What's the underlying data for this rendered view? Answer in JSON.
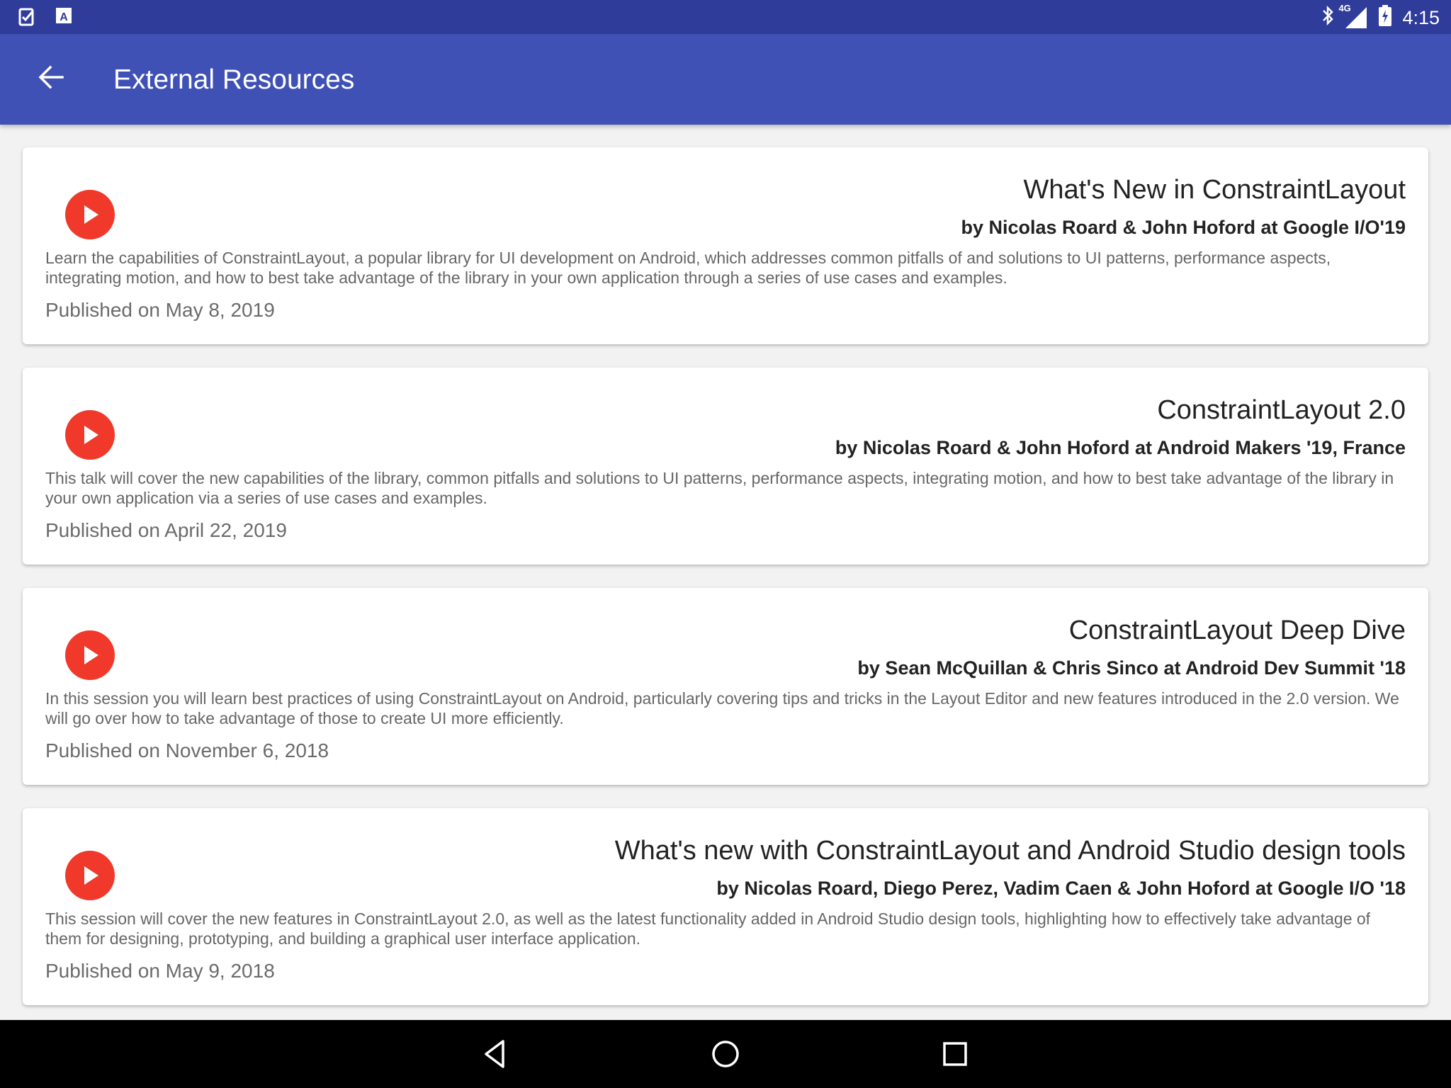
{
  "status_bar": {
    "time": "4:15",
    "network": "4G",
    "icons": [
      "checklist-icon",
      "font-a-icon",
      "bluetooth-icon",
      "signal-icon",
      "battery-icon"
    ]
  },
  "app_bar": {
    "title": "External Resources",
    "back_icon": "arrow-left-icon",
    "color": "#3f51b5"
  },
  "resources": [
    {
      "title": "What's New in ConstraintLayout",
      "author": "by Nicolas Roard & John Hoford at Google I/O'19",
      "description": "Learn the capabilities of ConstraintLayout, a popular library for UI development on Android, which addresses common pitfalls of and solutions to UI patterns, performance aspects, integrating motion, and how to best take advantage of the library in your own application through a series of use cases and examples.",
      "date": "Published on May 8, 2019"
    },
    {
      "title": "ConstraintLayout 2.0",
      "author": "by Nicolas Roard & John Hoford at Android Makers '19, France",
      "description": "This talk will cover the new capabilities of the library, common pitfalls and solutions to UI patterns, performance aspects, integrating motion, and how to best take advantage of the library in your own application via a series of use cases and examples.",
      "date": "Published on April 22, 2019"
    },
    {
      "title": "ConstraintLayout Deep Dive",
      "author": "by Sean McQuillan & Chris Sinco at Android Dev Summit '18",
      "description": "In this session you will learn best practices of using ConstraintLayout on Android, particularly covering tips and tricks in the Layout Editor and new features introduced in the 2.0 version. We will go over how to take advantage of those to create UI more efficiently.",
      "date": "Published on November 6, 2018"
    },
    {
      "title": "What's new with ConstraintLayout and Android Studio design tools",
      "author": "by Nicolas Roard, Diego Perez, Vadim Caen & John Hoford at Google I/O '18",
      "description": "This session will cover the new features in ConstraintLayout 2.0, as well as the latest functionality added in Android Studio design tools, highlighting how to effectively take advantage of them for designing, prototyping, and building a graphical user interface application.",
      "date": "Published on May 9, 2018"
    }
  ],
  "play_icon": "play-circle-icon",
  "play_color": "#f0392b",
  "nav_bar": {
    "buttons": [
      "back-triangle-icon",
      "home-circle-icon",
      "recents-square-icon"
    ]
  }
}
